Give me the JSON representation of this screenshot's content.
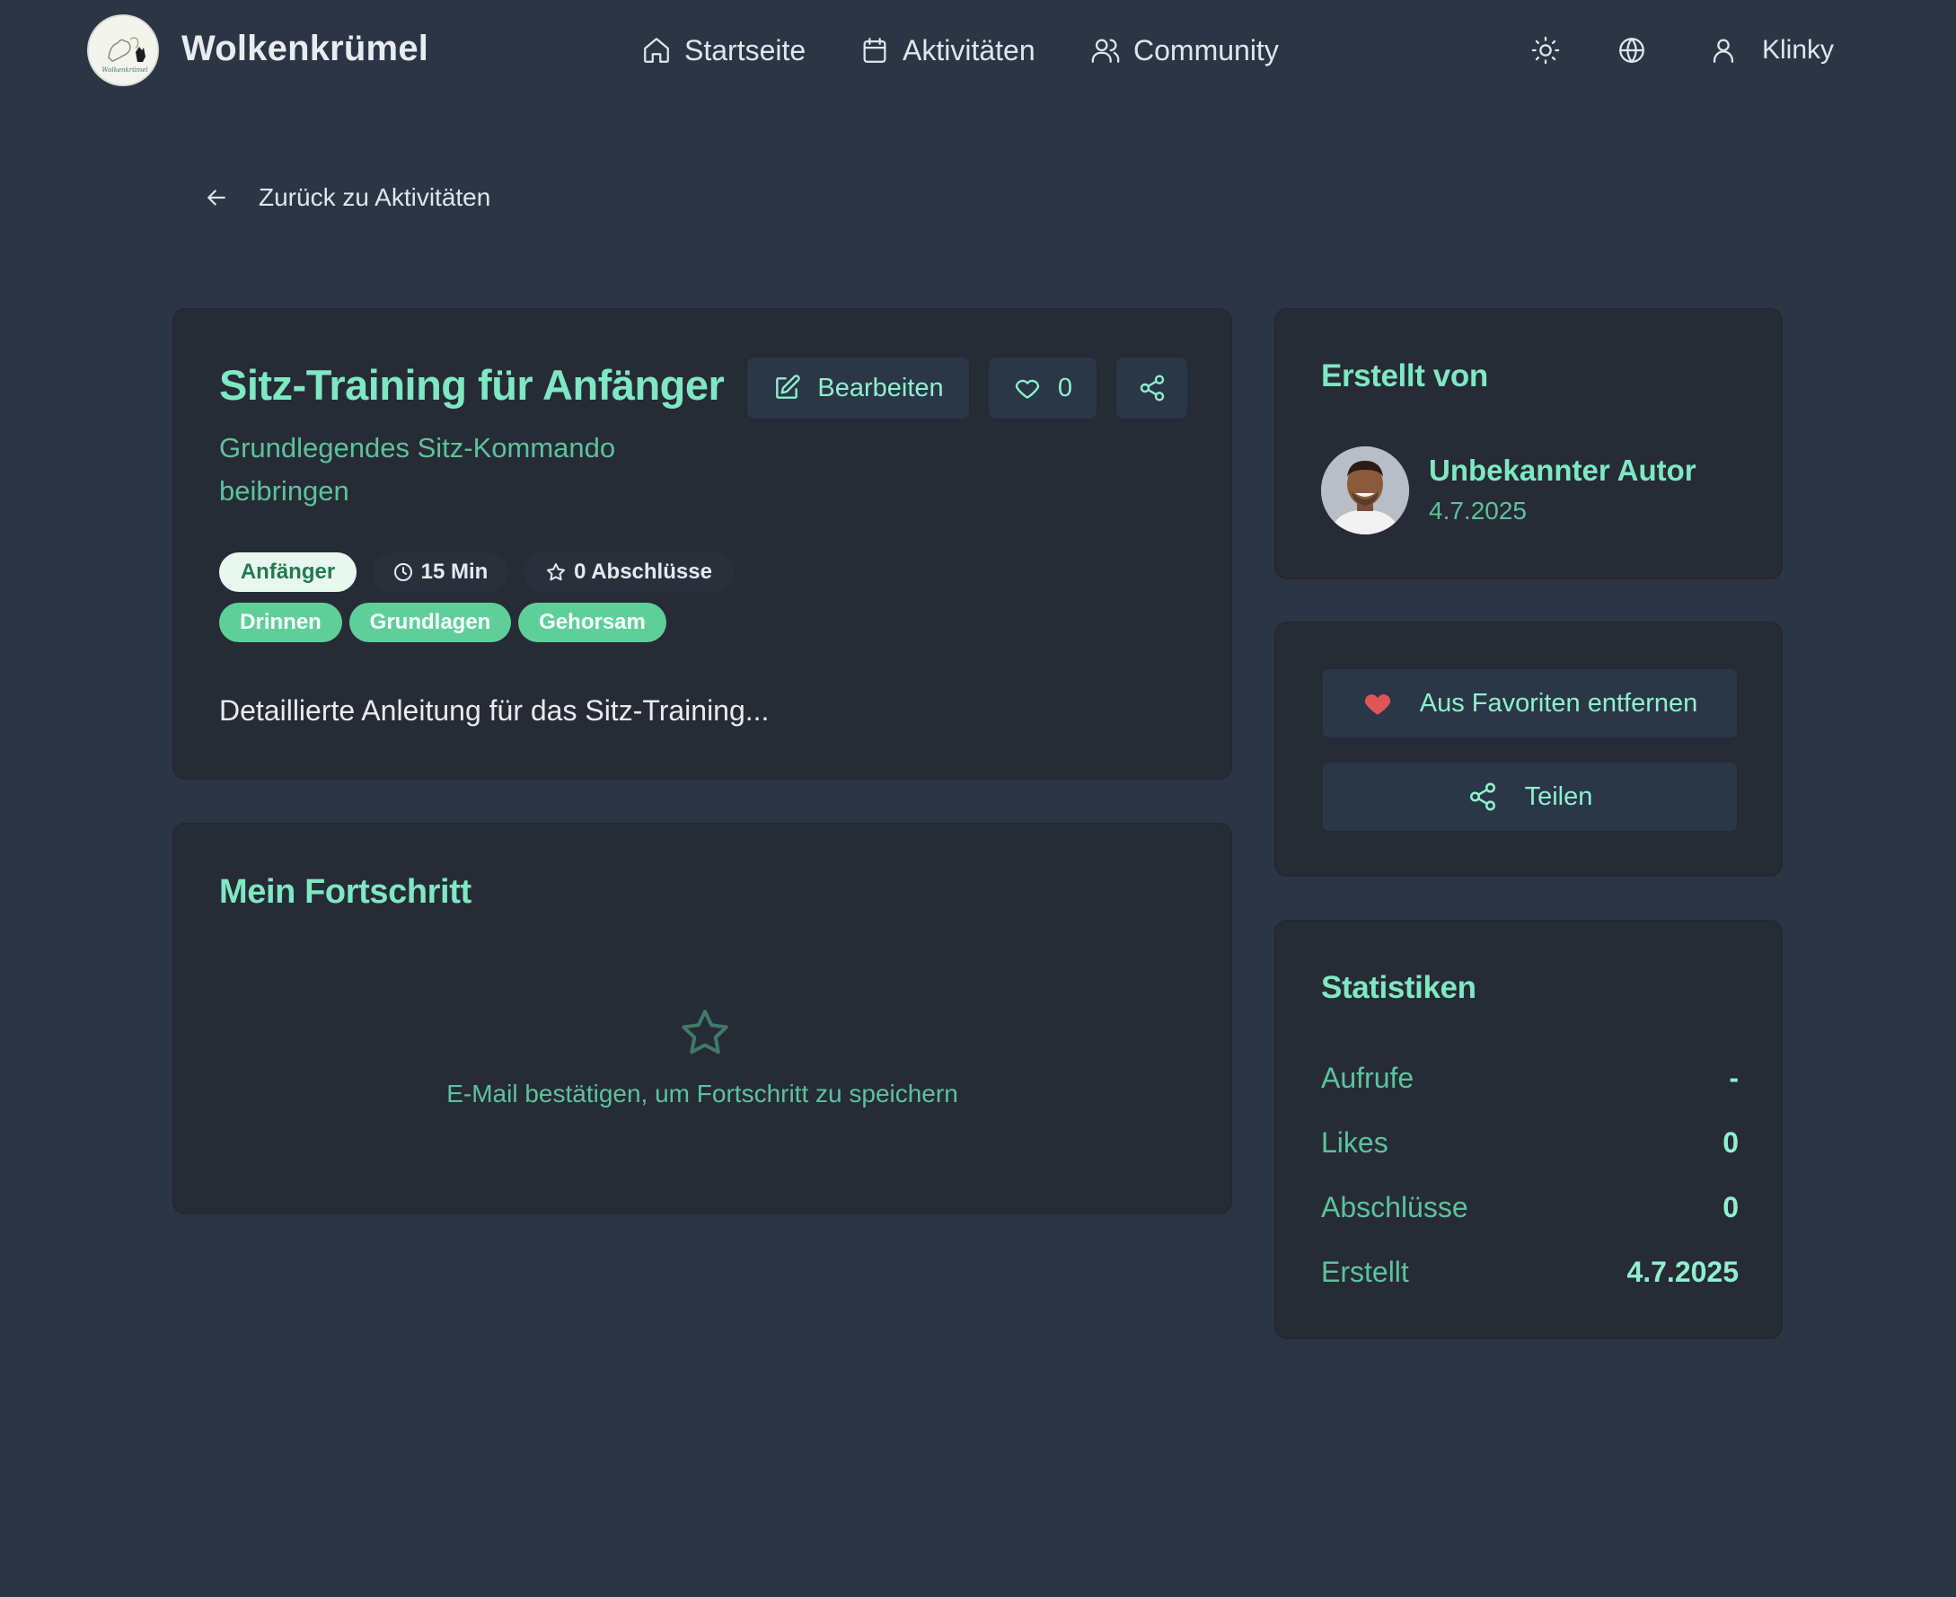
{
  "header": {
    "brand": "Wolkenkrümel",
    "logo_text": "Wolkenkrümel",
    "nav": [
      {
        "label": "Startseite",
        "icon": "home-icon"
      },
      {
        "label": "Aktivitäten",
        "icon": "calendar-icon"
      },
      {
        "label": "Community",
        "icon": "users-icon"
      }
    ],
    "theme_icon": "sun-icon",
    "language_icon": "globe-icon",
    "user_name": "Klinky"
  },
  "back_link": "Zurück zu Aktivitäten",
  "activity": {
    "title": "Sitz-Training für Anfänger",
    "subtitle": "Grundlegendes Sitz-Kommando beibringen",
    "edit_label": "Bearbeiten",
    "like_count": "0",
    "level": "Anfänger",
    "duration": "15 Min",
    "completions": "0 Abschlüsse",
    "tags": [
      "Drinnen",
      "Grundlagen",
      "Gehorsam"
    ],
    "description": "Detaillierte Anleitung für das Sitz-Training..."
  },
  "progress": {
    "title": "Mein Fortschritt",
    "empty_text": "E-Mail bestätigen, um Fortschritt zu speichern"
  },
  "author": {
    "title": "Erstellt von",
    "name": "Unbekannter Autor",
    "date": "4.7.2025"
  },
  "actions": {
    "favorite_label": "Aus Favoriten entfernen",
    "share_label": "Teilen"
  },
  "stats": {
    "title": "Statistiken",
    "rows": [
      {
        "label": "Aufrufe",
        "value": "-"
      },
      {
        "label": "Likes",
        "value": "0"
      },
      {
        "label": "Abschlüsse",
        "value": "0"
      },
      {
        "label": "Erstellt",
        "value": "4.7.2025"
      }
    ]
  },
  "colors": {
    "background": "#2b3544",
    "card": "#262b35",
    "accent": "#7ee8c2",
    "tag": "#5fcf9a",
    "heart": "#e05555"
  }
}
